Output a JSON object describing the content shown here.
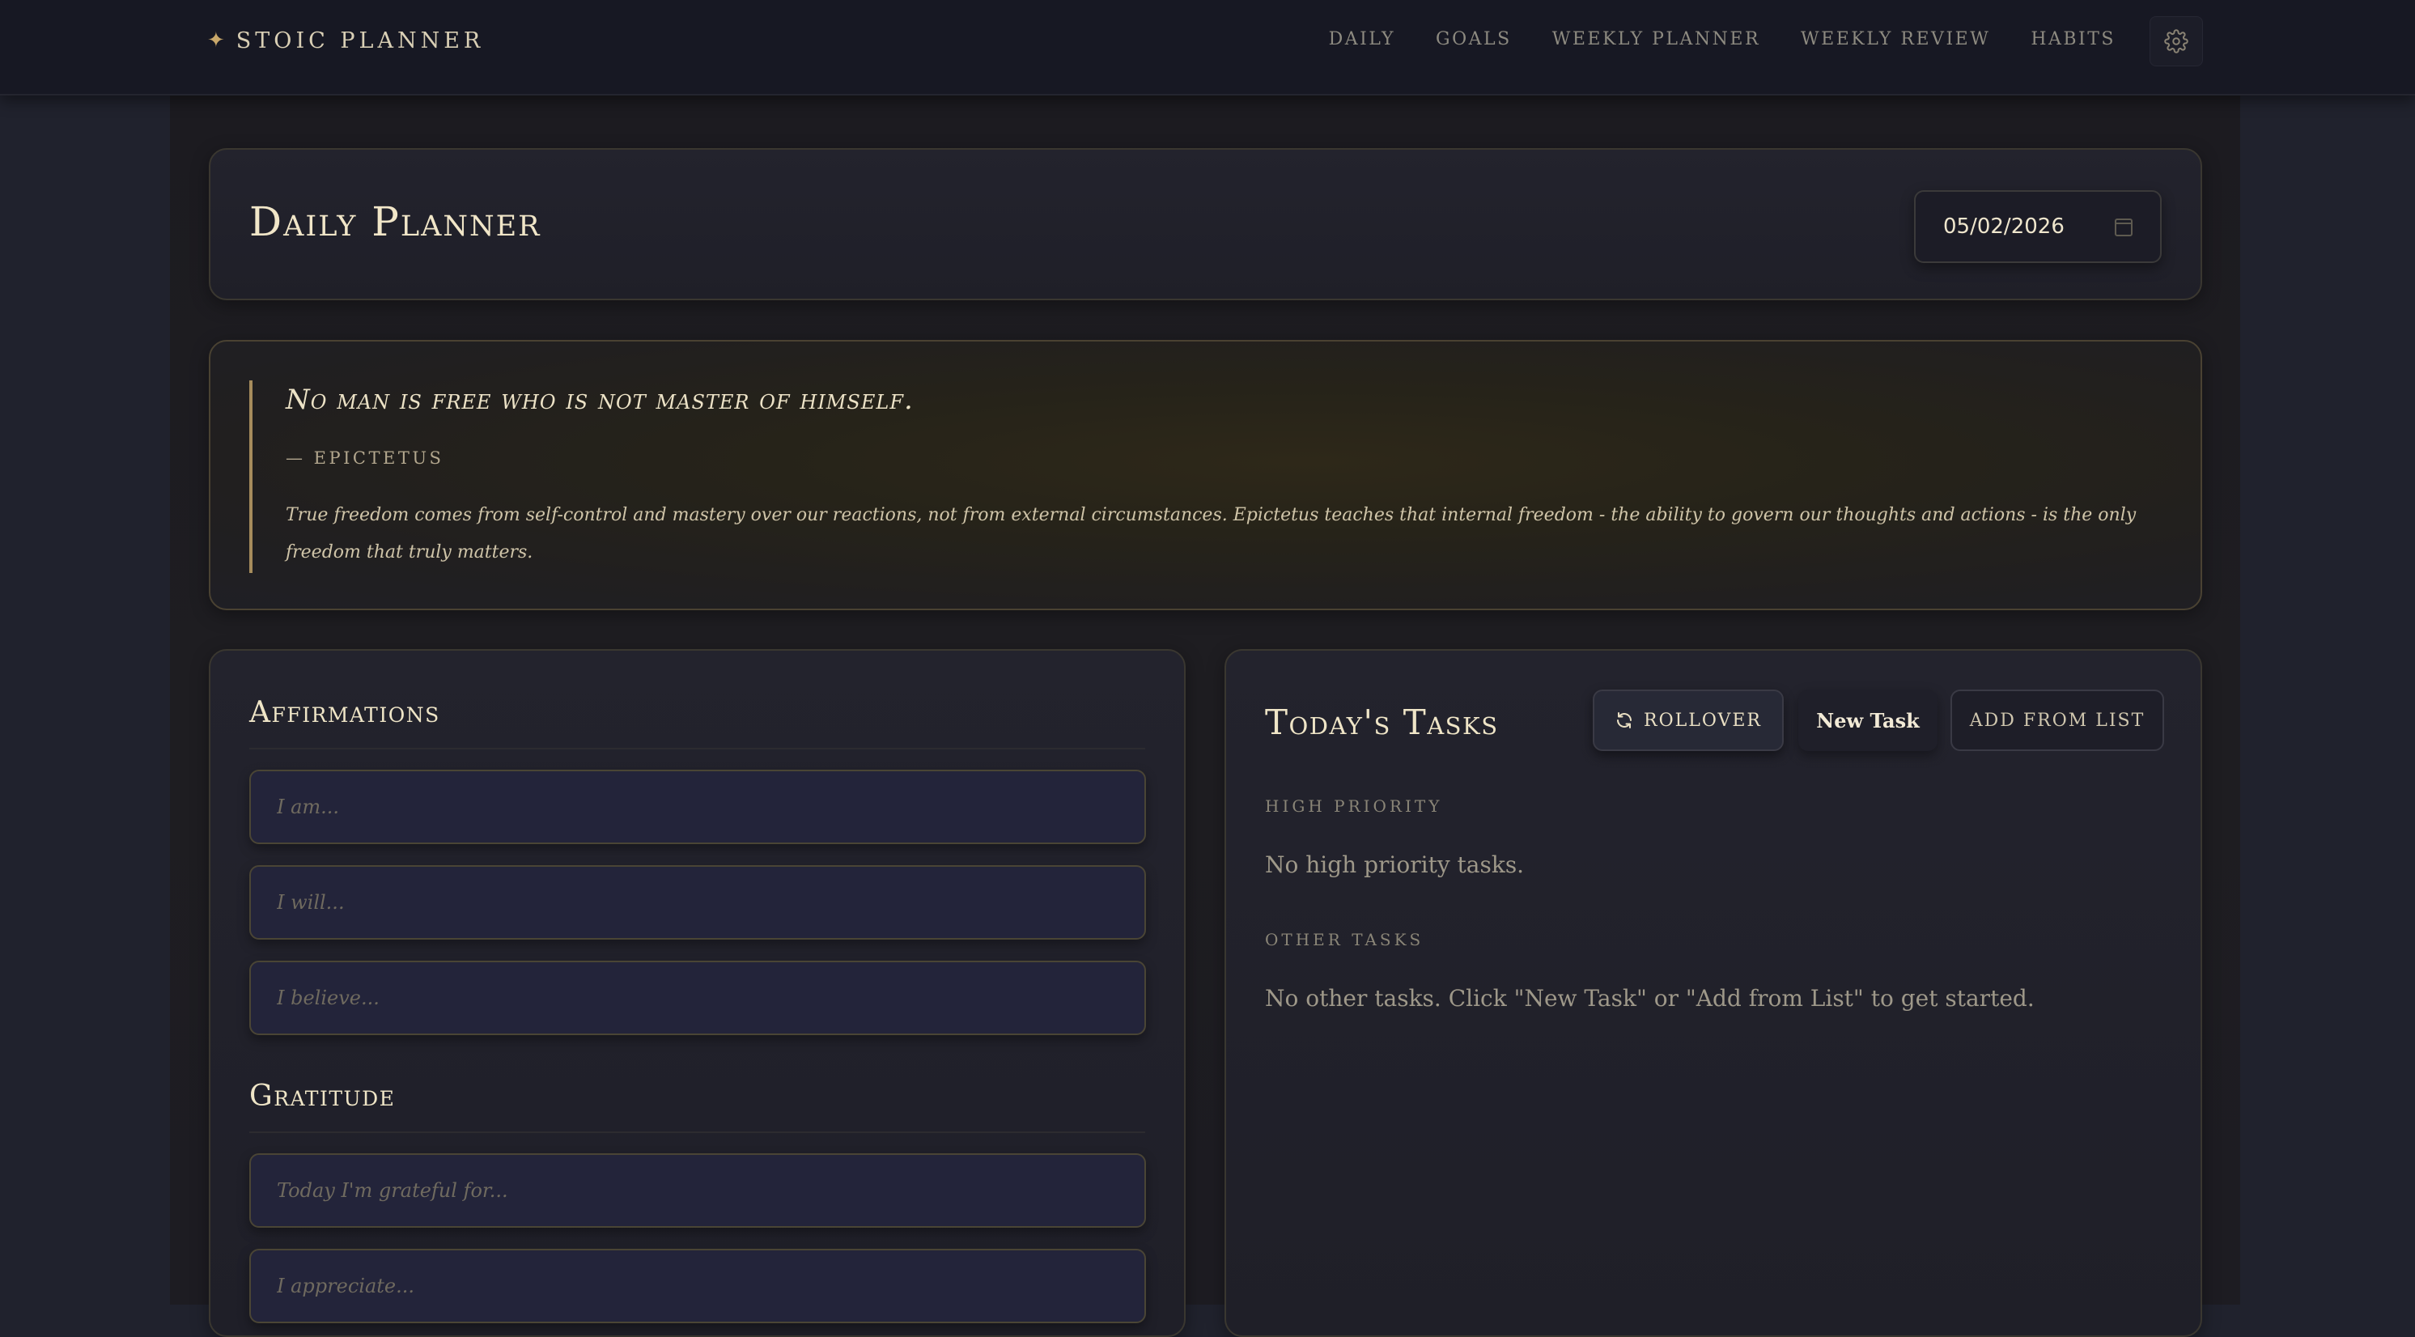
{
  "nav": {
    "brand": "STOIC PLANNER",
    "brand_icon": "✦",
    "items": [
      {
        "label": "DAILY"
      },
      {
        "label": "GOALS"
      },
      {
        "label": "WEEKLY PLANNER"
      },
      {
        "label": "WEEKLY REVIEW"
      },
      {
        "label": "HABITS"
      }
    ],
    "settings_icon": "gear-icon"
  },
  "header": {
    "title": "Daily Planner",
    "date_value": "05/02/2026"
  },
  "quote": {
    "text": "No man is free who is not master of himself.",
    "author": "— EPICTETUS",
    "explanation": "True freedom comes from self-control and mastery over our reactions, not from external circumstances. Epictetus teaches that internal freedom - the ability to govern our thoughts and actions - is the only freedom that truly matters."
  },
  "affirmations": {
    "title": "Affirmations",
    "placeholders": [
      "I am...",
      "I will...",
      "I believe..."
    ]
  },
  "gratitude": {
    "title": "Gratitude",
    "placeholders": [
      "Today I'm grateful for...",
      "I appreciate..."
    ]
  },
  "tasks": {
    "title": "Today's Tasks",
    "rollover_label": "ROLLOVER",
    "new_task_label": "New Task",
    "add_from_list_label": "ADD FROM LIST",
    "high_priority_label": "HIGH PRIORITY",
    "high_priority_empty": "No high priority tasks.",
    "other_label": "OTHER TASKS",
    "other_empty": "No other tasks. Click \"New Task\" or \"Add from List\" to get started."
  },
  "colors": {
    "accent_gold": "#c9a86a",
    "background": "#20222d",
    "card_border": "#3a3730"
  }
}
